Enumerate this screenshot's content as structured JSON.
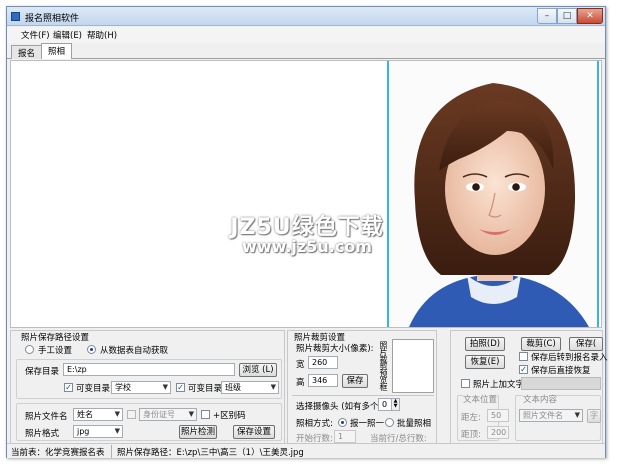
{
  "window": {
    "title": "报名照相软件",
    "controls": {
      "minimize": "–",
      "maximize": "□",
      "close": "✕"
    }
  },
  "menu": [
    "文件(F)",
    "编辑(E)",
    "帮助(H)"
  ],
  "tabs": [
    {
      "label": "报名",
      "active": false
    },
    {
      "label": "照相",
      "active": true
    }
  ],
  "watermark": {
    "main": "JZ5U绿色下载",
    "url": "www.jz5u.com"
  },
  "photo_path_panel": {
    "legend": "照片保存路径设置",
    "radio_manual": "手工设置",
    "radio_auto": "从数据表自动获取",
    "save_dir_label": "保存目录",
    "save_dir_value": "E:\\zp",
    "browse_button": "浏览 (L)",
    "subdir1_label": "可变目录1",
    "subdir1_value": "学校",
    "subdir2_label": "可变目录2",
    "subdir2_value": "班级",
    "filename_label": "照片文件名",
    "filename_value": "姓名",
    "filename_extra_value": "身份证号",
    "distinguish_label": "+区别码",
    "format_label": "照片格式",
    "format_value": "jpg",
    "photo_check_button": "照片检测",
    "save_settings_button": "保存设置"
  },
  "crop_panel": {
    "legend": "照片裁剪设置",
    "size_label": "照片裁剪大小(像素):",
    "width_label": "宽",
    "width_value": "260",
    "height_label": "高",
    "height_value": "346",
    "save_button": "保存",
    "side_hint": "照片裁剪预览框",
    "camera_label": "选择摄像头 (如有多个):",
    "camera_value": "0",
    "mode_label": "照相方式:",
    "mode_one": "报一照一",
    "mode_batch": "批量照相",
    "start_row_label": "开始行数:",
    "start_row_value": "1",
    "current_row_label": "当前行/总行数:"
  },
  "actions_panel": {
    "capture_button": "拍照(D)",
    "crop_button": "裁剪(C)",
    "save_button": "保存(",
    "restore_button": "恢复(E)",
    "jump_after_save": "保存后转到报名录入",
    "restore_after_save": "保存后直接恢复",
    "add_text_label": "照片上加文字",
    "text_pos_label": "文本位置",
    "text_content_label": "文本内容",
    "from_left_label": "距左:",
    "from_left_value": "50",
    "from_top_label": "距顶:",
    "from_top_value": "200",
    "text_content_value": "照片文件名",
    "font_button": "字"
  },
  "status": {
    "table": "当前表：化学竞赛报名表",
    "path": "照片保存路径：E:\\zp\\三中\\高三（1）\\王美灵.jpg"
  }
}
